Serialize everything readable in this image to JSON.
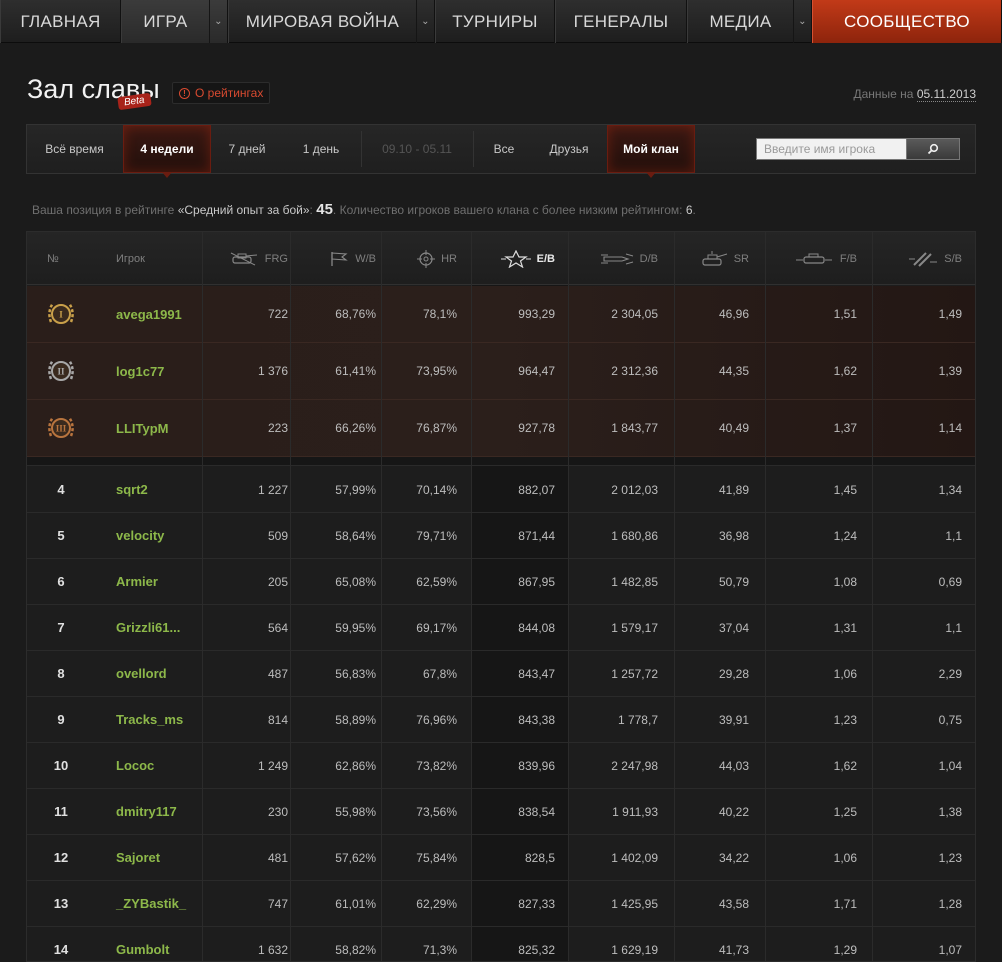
{
  "nav": {
    "items": [
      {
        "label": "Главная"
      },
      {
        "label": "Игра"
      },
      {
        "label": "Мировая война"
      },
      {
        "label": "Турниры"
      },
      {
        "label": "Генералы"
      },
      {
        "label": "Медиа"
      },
      {
        "label": "Сообщество"
      }
    ]
  },
  "header": {
    "title": "Зал славы",
    "beta": "Beta",
    "ratings_link": "О рейтингах",
    "date_label": "Данные на",
    "date_value": "05.11.2013"
  },
  "filters": {
    "periods": [
      "Всё время",
      "4 недели",
      "7 дней",
      "1 день",
      "09.10 - 05.11"
    ],
    "groups": [
      "Все",
      "Друзья",
      "Мой клан"
    ],
    "active_period": "4 недели",
    "active_group": "Мой клан"
  },
  "search": {
    "placeholder": "Введите имя игрока"
  },
  "position_info": {
    "prefix": "Ваша позиция в рейтинге",
    "rating_name": "«Средний опыт за бой»",
    "position": "45",
    "suffix": ". Количество игроков вашего клана с более низким рейтингом:",
    "count": "6",
    "end": "."
  },
  "table": {
    "columns": {
      "rank": "№",
      "player": "Игрок",
      "frg": "FRG",
      "wb": "W/B",
      "hr": "HR",
      "eb": "E/B",
      "db": "D/B",
      "sr": "SR",
      "fb": "F/B",
      "sb": "S/B"
    },
    "top_rows": [
      {
        "medal": "I",
        "player": "avega1991",
        "frg": "722",
        "wb": "68,76%",
        "hr": "78,1%",
        "eb": "993,29",
        "db": "2 304,05",
        "sr": "46,96",
        "fb": "1,51",
        "sb": "1,49"
      },
      {
        "medal": "II",
        "player": "log1c77",
        "frg": "1 376",
        "wb": "61,41%",
        "hr": "73,95%",
        "eb": "964,47",
        "db": "2 312,36",
        "sr": "44,35",
        "fb": "1,62",
        "sb": "1,39"
      },
      {
        "medal": "III",
        "player": "LLITypM",
        "frg": "223",
        "wb": "66,26%",
        "hr": "76,87%",
        "eb": "927,78",
        "db": "1 843,77",
        "sr": "40,49",
        "fb": "1,37",
        "sb": "1,14"
      }
    ],
    "rows": [
      {
        "rank": "4",
        "player": "sqrt2",
        "frg": "1 227",
        "wb": "57,99%",
        "hr": "70,14%",
        "eb": "882,07",
        "db": "2 012,03",
        "sr": "41,89",
        "fb": "1,45",
        "sb": "1,34"
      },
      {
        "rank": "5",
        "player": "velocity",
        "frg": "509",
        "wb": "58,64%",
        "hr": "79,71%",
        "eb": "871,44",
        "db": "1 680,86",
        "sr": "36,98",
        "fb": "1,24",
        "sb": "1,1"
      },
      {
        "rank": "6",
        "player": "Armier",
        "frg": "205",
        "wb": "65,08%",
        "hr": "62,59%",
        "eb": "867,95",
        "db": "1 482,85",
        "sr": "50,79",
        "fb": "1,08",
        "sb": "0,69"
      },
      {
        "rank": "7",
        "player": "Grizzli61...",
        "frg": "564",
        "wb": "59,95%",
        "hr": "69,17%",
        "eb": "844,08",
        "db": "1 579,17",
        "sr": "37,04",
        "fb": "1,31",
        "sb": "1,1"
      },
      {
        "rank": "8",
        "player": "ovellord",
        "frg": "487",
        "wb": "56,83%",
        "hr": "67,8%",
        "eb": "843,47",
        "db": "1 257,72",
        "sr": "29,28",
        "fb": "1,06",
        "sb": "2,29"
      },
      {
        "rank": "9",
        "player": "Tracks_ms",
        "frg": "814",
        "wb": "58,89%",
        "hr": "76,96%",
        "eb": "843,38",
        "db": "1 778,7",
        "sr": "39,91",
        "fb": "1,23",
        "sb": "0,75"
      },
      {
        "rank": "10",
        "player": "Locoс",
        "frg": "1 249",
        "wb": "62,86%",
        "hr": "73,82%",
        "eb": "839,96",
        "db": "2 247,98",
        "sr": "44,03",
        "fb": "1,62",
        "sb": "1,04"
      },
      {
        "rank": "11",
        "player": "dmitry117",
        "frg": "230",
        "wb": "55,98%",
        "hr": "73,56%",
        "eb": "838,54",
        "db": "1 911,93",
        "sr": "40,22",
        "fb": "1,25",
        "sb": "1,38"
      },
      {
        "rank": "12",
        "player": "Sajoret",
        "frg": "481",
        "wb": "57,62%",
        "hr": "75,84%",
        "eb": "828,5",
        "db": "1 402,09",
        "sr": "34,22",
        "fb": "1,06",
        "sb": "1,23"
      },
      {
        "rank": "13",
        "player": "_ZYBastik_",
        "frg": "747",
        "wb": "61,01%",
        "hr": "62,29%",
        "eb": "827,33",
        "db": "1 425,95",
        "sr": "43,58",
        "fb": "1,71",
        "sb": "1,28"
      },
      {
        "rank": "14",
        "player": "Gumbolt",
        "frg": "1 632",
        "wb": "58,82%",
        "hr": "71,3%",
        "eb": "825,32",
        "db": "1 629,19",
        "sr": "41,73",
        "fb": "1,29",
        "sb": "1,07"
      }
    ]
  },
  "colors": {
    "accent_red": "#c23a18",
    "player_green": "#8db84a",
    "medal_gold": "#c9a04a",
    "medal_silver": "#a8a8a8",
    "medal_bronze": "#b8743e"
  },
  "icons": {
    "frg": "tank-kill-icon",
    "wb": "flag-icon",
    "hr": "crosshair-icon",
    "eb": "star-icon",
    "db": "shell-icon",
    "sr": "tank-spot-icon",
    "fb": "tank-icon",
    "sb": "shells-icon",
    "search": "search-icon",
    "info": "info-icon"
  }
}
